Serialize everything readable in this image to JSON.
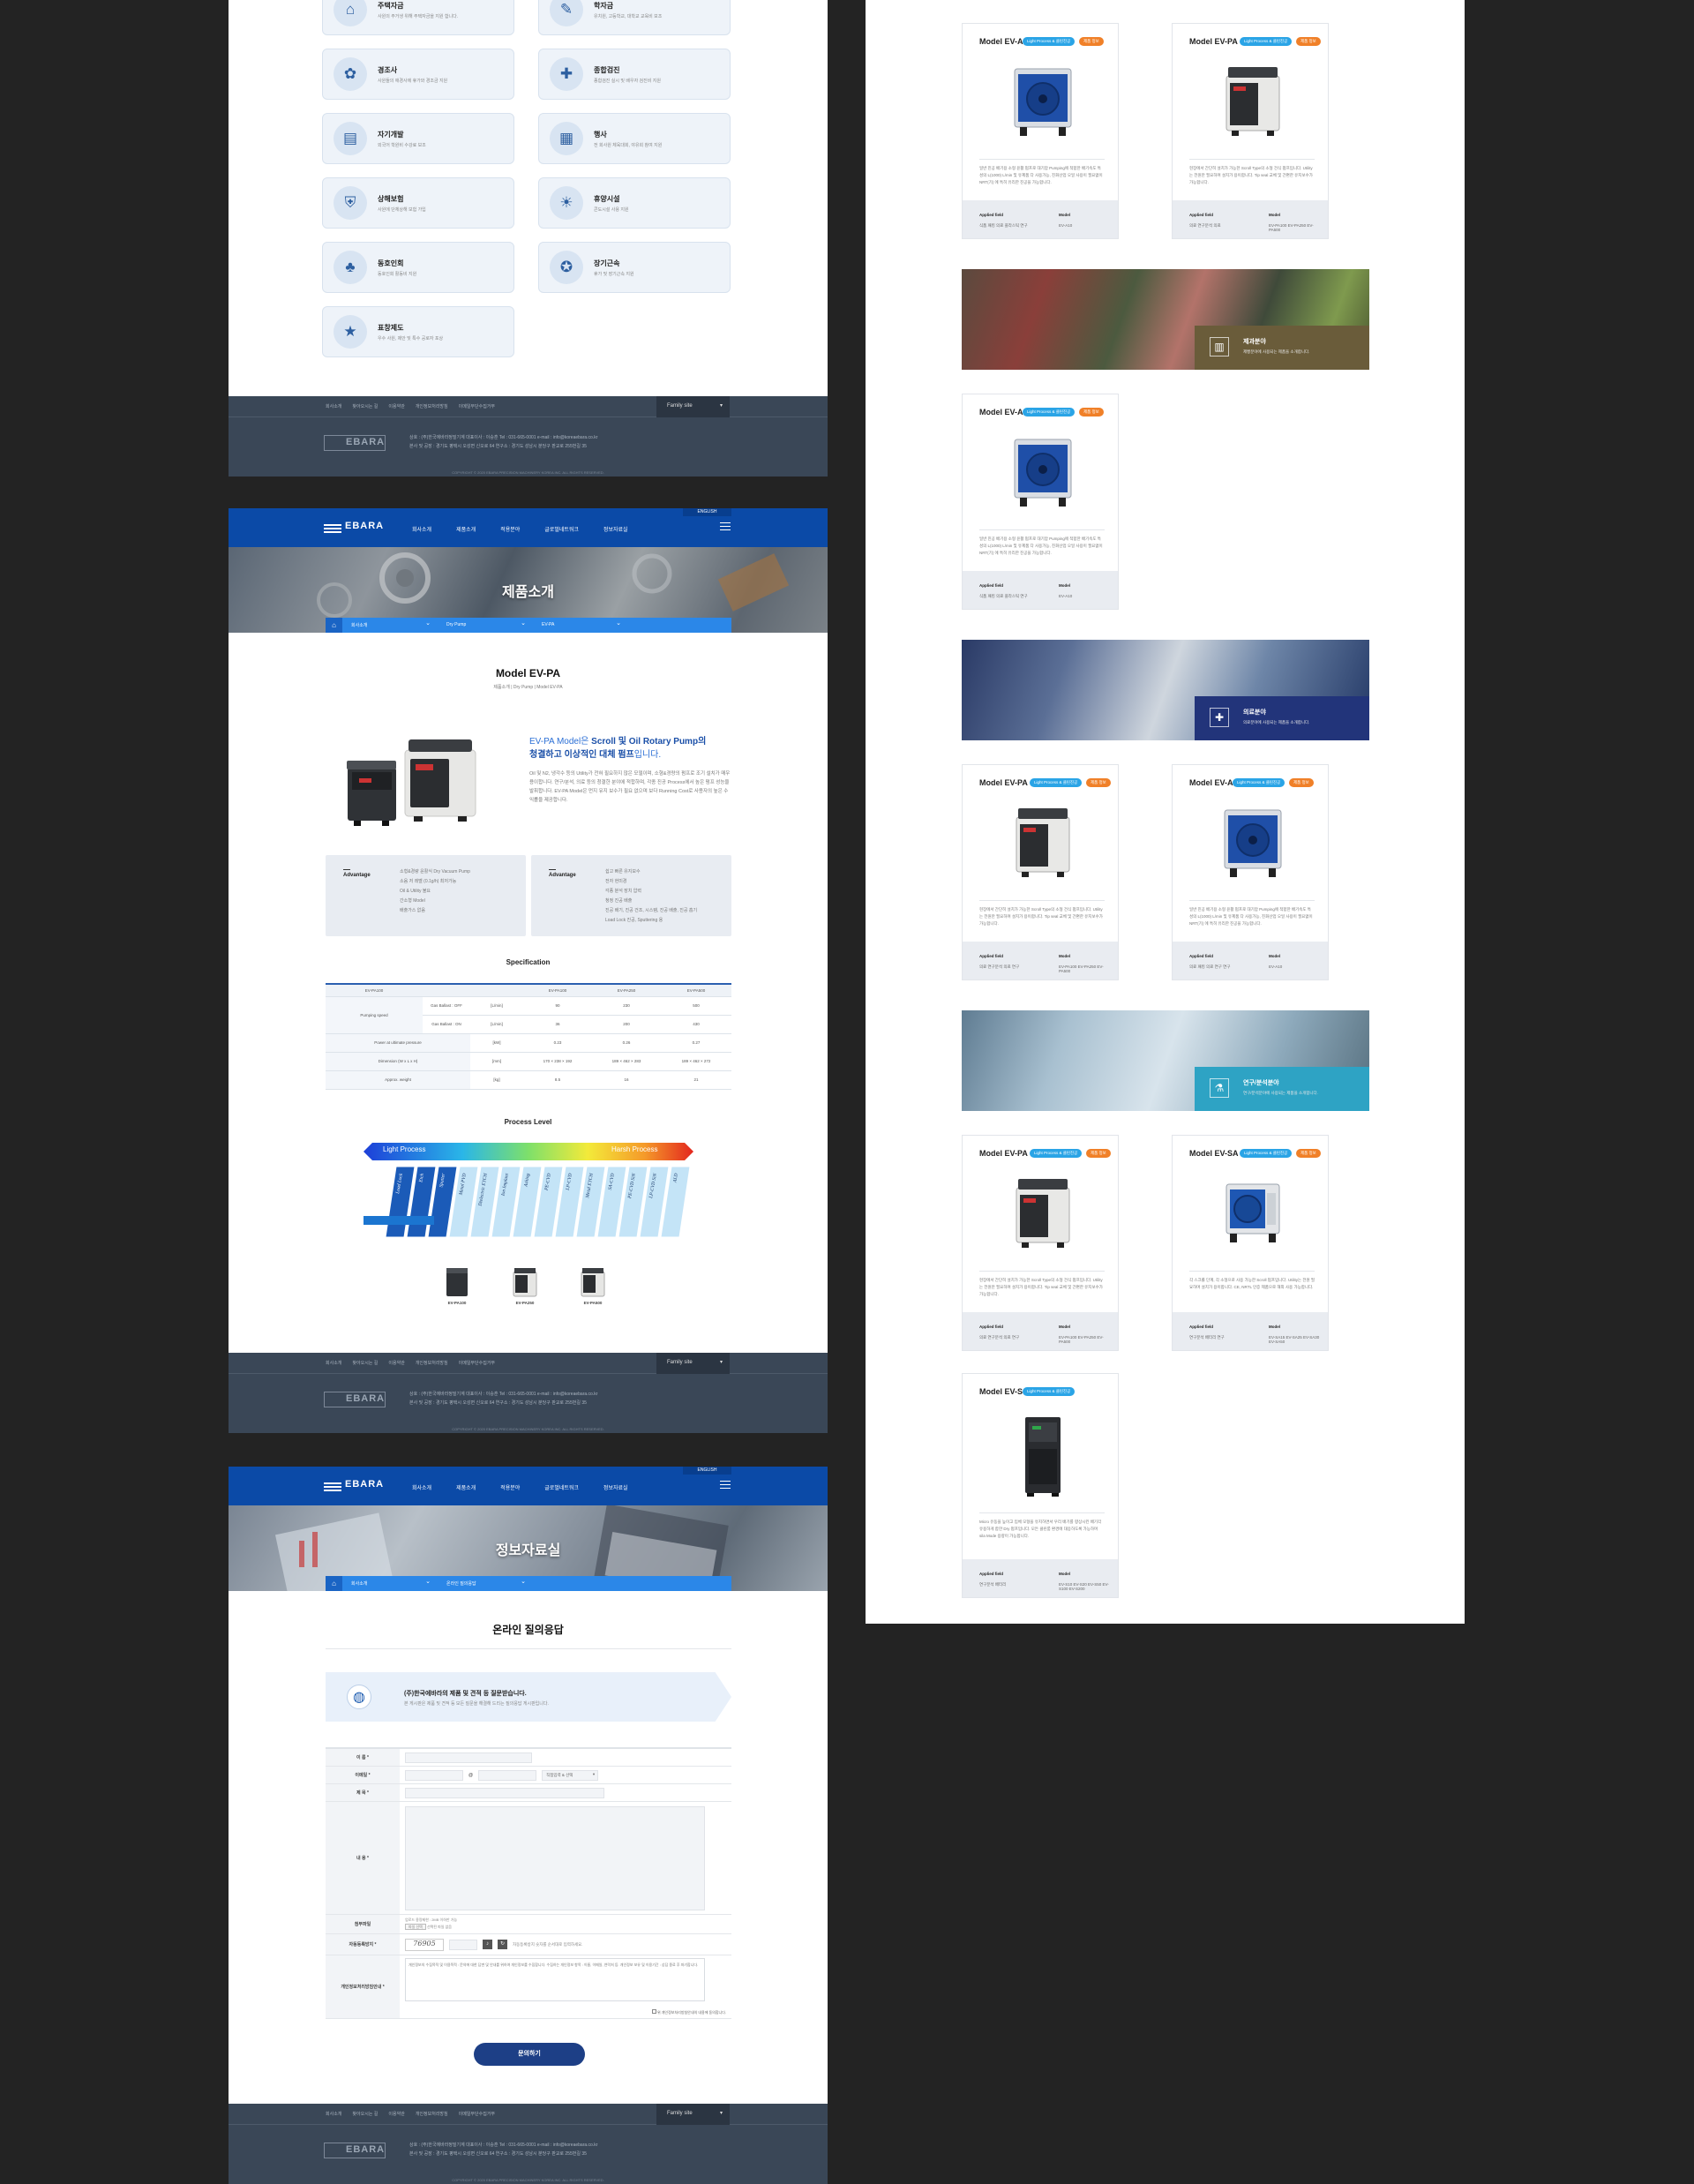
{
  "p1": {
    "benefits": [
      {
        "title": "주택자금",
        "desc": "사원의 주거생 위해 주택자금을 지원 합니다.",
        "icon": "house-icon"
      },
      {
        "title": "학자금",
        "desc": "유치원, 고등학교, 대학교 교육비 보조",
        "icon": "graduation-icon"
      },
      {
        "title": "경조사",
        "desc": "사원들의 애경사에 휴가와 경조금 지원",
        "icon": "gift-icon"
      },
      {
        "title": "종합검진",
        "desc": "종합검진 실시 및 배우자 검진비 지원",
        "icon": "checkup-icon"
      },
      {
        "title": "자기개발",
        "desc": "외국어 학원비 수강료 보조",
        "icon": "book-icon"
      },
      {
        "title": "행사",
        "desc": "전 회사원 체육대회, 야유회 참여 지원",
        "icon": "calendar-icon"
      },
      {
        "title": "상해보험",
        "desc": "사원에 단체상해 보험 가입",
        "icon": "insurance-icon"
      },
      {
        "title": "휴양시설",
        "desc": "콘도시설 사용 지원",
        "icon": "resort-icon"
      },
      {
        "title": "동호인회",
        "desc": "동호인회 활동비 지원",
        "icon": "club-icon"
      },
      {
        "title": "장기근속",
        "desc": "휴가 및 장기근속 지원",
        "icon": "medal-icon"
      },
      {
        "title": "표창제도",
        "desc": "우수 사원, 제안 및 특수 공로자 포상",
        "icon": "award-icon"
      }
    ]
  },
  "footer": {
    "links": [
      "회사소개",
      "찾아오시는 길",
      "이용약관",
      "개인정보처리방침",
      "이메일무단수집거부"
    ],
    "family_site": "Family site",
    "logo": "EBARA",
    "address_line1": "상호 : (주)한국에바라정밀기계   대표이사 : 이승훈   Tel : 031-665-0001   e-mail : info@koreaebara.co.kr",
    "address_line2": "본사 및 공장 : 경기도 평택시 오성면 신오로 64   연구소 : 경기도 성남시 분당구 판교로 255번길 35",
    "copyright": "COPYRIGHT © 2020 EBARA PRECISION MACHINERY KOREA INC. ALL RIGHTS RESERVED."
  },
  "gnb": {
    "logo": "EBARA",
    "menu": [
      "회사소개",
      "제품소개",
      "적용분야",
      "글로벌네트워크",
      "정보자료실"
    ],
    "lang": "ENGLISH"
  },
  "p2": {
    "hero_title": "제품소개",
    "crumbs": [
      "회사소개",
      "Dry Pump",
      "EV-PA"
    ],
    "page_title": "Model EV-PA",
    "sub_crumb": "제품소개   |   Dry Pump   |   Model EV-PA",
    "intro_head_1a": "EV-PA Model은 ",
    "intro_head_1b": "Scroll 및 Oil Rotary Pump",
    "intro_head_1c": "의",
    "intro_head_2a": "청결하고 이상적인 대체 펌프",
    "intro_head_2b": "입니다.",
    "intro_body": "Oil 및 N2, 냉각수 등의 Utility가 전혀 필요하지 않은 모델이며, 소형&경량의 펌프로 조기 설치가 매우 용이합니다. 연구/분석, 의료 등의 청결한 분야에 적합하며, 각종 진공 Process에서 높은 펌프 성능을 발휘합니다. EV-PA Model은 먼지 유지 보수가 필요 없으며 보다 Running Cost로 사용자의 높은 수익률을 제공합니다.",
    "adv_label": "Advantage",
    "adv1": [
      "소형&경량 윤활식 Dry Vacuum Pump",
      "소음 저 레벨 (0.1g/h) 최저가능",
      "Oil & Utility 불요",
      "간소형 Model",
      "배출가스 없음"
    ],
    "adv2": [
      "쉽고 빠른 유지보수",
      "전자 현미경",
      "각종 분석 장치 압력",
      "청정 진공 배출",
      "진공 배기, 진공 건조, 시스템, 진공 배출, 진공 흡기",
      "Load Lock 진공, Sputtering 용"
    ],
    "spec_title": "Specification",
    "spec_head": [
      "EV-PA100",
      "",
      "",
      "EV-PA100",
      "EV-PA250",
      "EV-PA500"
    ],
    "spec_rows": [
      {
        "label": "Pumping speed",
        "sub": "Gas Ballast : OFF",
        "unit": "[L/min]",
        "v": [
          "90",
          "230",
          "500"
        ]
      },
      {
        "label": "",
        "sub": "Gas Ballast : ON",
        "unit": "[L/min]",
        "v": [
          "36",
          "200",
          "430"
        ]
      },
      {
        "label": "Power at ultimate pressure",
        "sub": "",
        "unit": "[kW]",
        "v": [
          "0.23",
          "0.26",
          "0.27"
        ]
      },
      {
        "label": "Dimension (W x L x H)",
        "sub": "",
        "unit": "[mm]",
        "v": [
          "170 × 238 × 192",
          "189 × 462 × 283",
          "189 × 462 × 272"
        ]
      },
      {
        "label": "Approx. weight",
        "sub": "",
        "unit": "[kg]",
        "v": [
          "8.5",
          "16",
          "21"
        ]
      }
    ],
    "process_title": "Process Level",
    "light_process": "Light Process",
    "harsh_process": "Harsh Process",
    "process_labels": [
      "Load Lock",
      "Etch",
      "Sputter",
      "Metal PVD",
      "Dielectric ETCH",
      "Ion Implant",
      "Ashing",
      "PE-CVD",
      "LP-CVD",
      "Metal ETCH",
      "SA-CVD",
      "PE-CVD SiN",
      "LP-CVD SiN",
      "ALD"
    ],
    "products": [
      "EV-PA100",
      "EV-PA250",
      "EV-PA500"
    ]
  },
  "p3": {
    "hero_title": "정보자료실",
    "crumbs": [
      "회사소개",
      "온라인 질의응답"
    ],
    "page_title": "온라인 질의응답",
    "qa_title": "(주)한국에바라의 제품 및 견적 등 질문받습니다.",
    "qa_desc": "본 게시판은 제품 및 견적 등 모든 질문을 해결해 드리는 질의응답 게시판입니다.",
    "f_name": "이 름 *",
    "f_email": "이메일 *",
    "email_at": "@",
    "email_select": "직접입력 & 선택",
    "f_subject": "제 목 *",
    "f_content": "내 용 *",
    "f_file": "첨부파일",
    "file_note": "업로드 용량제한 : 2MB 이하만 가능",
    "file_btn": "파일 선택",
    "file_none": "선택된 파일 없음",
    "f_captcha": "자동등록방지 *",
    "captcha_code": "76905",
    "captcha_note": "자동등록방지 숫자를 순서대로 입력하세요.",
    "f_privacy": "개인정보처리방침안내 *",
    "privacy_text": "개인정보의 수집목적 및 이용목적 : 문의에 대한 답변 및 안내를 위하여 개인정보를 수집합니다. 수집하는 개인정보 항목 : 이름, 이메일, 연락처 등. 개인정보 보유 및 이용기간 : 상담 종료 후 파기합니다.",
    "privacy_agree": "위 개인정보처리방침안내의 내용에 동의합니다.",
    "submit": "문의하기"
  },
  "p4": {
    "cards": [
      {
        "name": "Model EV-A",
        "badge1": "Light Process & 클린진공",
        "badge2": "제품 정보",
        "desc": "일반 진공 배기용 소형 윤활 펌프로 대기압 Pumping에 적합한 배기속도 특성의 L(1000) L/min 및 유제품 다 사용가능, 진화산업 오일 사용이 필요없이 NRT(기) 에 특히 유리한 진공을 가능합니다.",
        "af": "Applied field",
        "md": "Model",
        "afv": "식품   패킹   의료   플라스틱   연구",
        "mdv": "EV-A10",
        "pump": "blue"
      },
      {
        "name": "Model EV-PA",
        "badge1": "Light Process & 클린진공",
        "badge2": "제품 정보",
        "desc": "현장에서 간단히 설치가 가능한 Scroll Type의 소형 건식 펌프입니다. Utility는 전원만 필요하며 설치가 용이합니다. Tip seal 교체 및 간편한 유지보수가 가능합니다.",
        "af": "Applied field",
        "md": "Model",
        "afv": "의료   연구분석   의료",
        "mdv": "EV-PA100   EV-PA250   EV-PA500",
        "pump": "white"
      },
      {
        "name": "Model EV-A",
        "badge1": "Light Process & 클린진공",
        "badge2": "제품 정보",
        "desc": "일반 진공 배기용 소형 윤활 펌프로 대기압 Pumping에 적합한 배기속도 특성의 L(1000) L/min 및 유제품 다 사용가능, 진화산업 오일 사용이 필요없이 NRT(기) 에 특히 유리한 진공을 가능합니다.",
        "af": "Applied field",
        "md": "Model",
        "afv": "식품   패킹   의료   플라스틱   연구",
        "mdv": "EV-A10",
        "pump": "blue"
      },
      {
        "name": "Model EV-PA",
        "badge1": "Light Process & 클린진공",
        "badge2": "제품 정보",
        "desc": "현장에서 간단히 설치가 가능한 Scroll Type의 소형 건식 펌프입니다. Utility는 전원만 필요하며 설치가 용이합니다. Tip seal 교체 및 간편한 유지보수가 가능합니다.",
        "af": "Applied field",
        "md": "Model",
        "afv": "의료   연구분석   의료   연구",
        "mdv": "EV-PA100   EV-PA250   EV-PA500",
        "pump": "white"
      },
      {
        "name": "Model EV-A",
        "badge1": "Light Process & 클린진공",
        "badge2": "제품 정보",
        "desc": "일반 진공 배기용 소형 윤활 펌프로 대기압 Pumping에 적합한 배기속도 특성의 L(1000) L/min 및 유제품 다 사용가능, 진화산업 오일 사용이 필요없이 NRT(기) 에 특히 유리한 진공을 가능합니다.",
        "af": "Applied field",
        "md": "Model",
        "afv": "의료   패킹   의료   연구   연구",
        "mdv": "EV-A10",
        "pump": "blue"
      },
      {
        "name": "Model EV-PA",
        "badge1": "Light Process & 클린진공",
        "badge2": "제품 정보",
        "desc": "현장에서 간단히 설치가 가능한 Scroll Type의 소형 건식 펌프입니다. Utility는 전원만 필요하며 설치가 용이합니다. Tip seal 교체 및 간편한 유지보수가 가능합니다.",
        "af": "Applied field",
        "md": "Model",
        "afv": "의료   연구분석   의료   연구",
        "mdv": "EV-PA100   EV-PA250   EV-PA500",
        "pump": "white"
      },
      {
        "name": "Model EV-SA",
        "badge1": "Light Process & 클린진공",
        "badge2": "제품 정보",
        "desc": "각 스크롤 단계, 각 소형으로 사용 가능한 Scroll 펌프입니다. Utility는 전원 필요하며 설치가 용이합니다. CE, NRTL 인증 제품으로 해외 사용 가능합니다.",
        "af": "Applied field",
        "md": "Model",
        "afv": "연구분석   배터리   연구",
        "mdv": "EV-SA15   EV-SA25   EV-SA30   EV-SA50",
        "pump": "blue2"
      },
      {
        "name": "Model EV-S",
        "badge1": "Light Process & 클린진공",
        "badge2": "",
        "desc": "Micro 유동을 높이고 입체 모형을 유지하면서 우리 배기를 향상시킨 배기각 유용하게 합한 Dry 펌프입니다. 모든 클린룸 환경에 대응하도록 가능하며 sila Mode 용량이 가능합니다.",
        "af": "Applied field",
        "md": "Model",
        "afv": "연구분석   배터리",
        "mdv": "EV-S10   EV-S20   EV-S50   EV-S100   EV-S200",
        "pump": "black"
      }
    ],
    "banners": [
      {
        "title": "제과분야",
        "desc": "제빵분야에 사용되는 제품을 소개합니다.",
        "icon": "factory-icon",
        "color": "#6a5c3a"
      },
      {
        "title": "의료분야",
        "desc": "의료분야에 사용되는 제품을 소개합니다.",
        "icon": "hospital-icon",
        "color": "#22347a"
      },
      {
        "title": "연구/분석분야",
        "desc": "연구/분석분야에 사용되는 제품을 소개합니다.",
        "icon": "lab-icon",
        "color": "#2ea3c4"
      }
    ]
  }
}
